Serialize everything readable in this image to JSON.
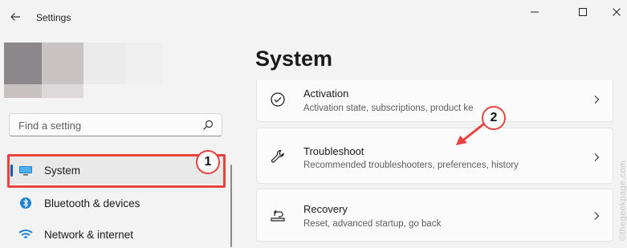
{
  "app": {
    "title": "Settings"
  },
  "search": {
    "placeholder": "Find a setting"
  },
  "sidebar": {
    "items": [
      {
        "label": "System",
        "icon": "monitor-icon",
        "selected": true
      },
      {
        "label": "Bluetooth & devices",
        "icon": "bluetooth-icon"
      },
      {
        "label": "Network & internet",
        "icon": "wifi-icon"
      }
    ]
  },
  "main": {
    "title": "System",
    "cards": [
      {
        "title": "Activation",
        "subtitle": "Activation state, subscriptions, product ke",
        "icon": "check-circle-icon"
      },
      {
        "title": "Troubleshoot",
        "subtitle": "Recommended troubleshooters, preferences, history",
        "icon": "wrench-icon"
      },
      {
        "title": "Recovery",
        "subtitle": "Reset, advanced startup, go back",
        "icon": "recovery-icon"
      }
    ]
  },
  "annotations": {
    "badge1": "1",
    "badge2": "2"
  },
  "watermark": "©thegeekpage.com",
  "colors": {
    "accent": "#005fb8",
    "highlight": "#e8433f"
  }
}
